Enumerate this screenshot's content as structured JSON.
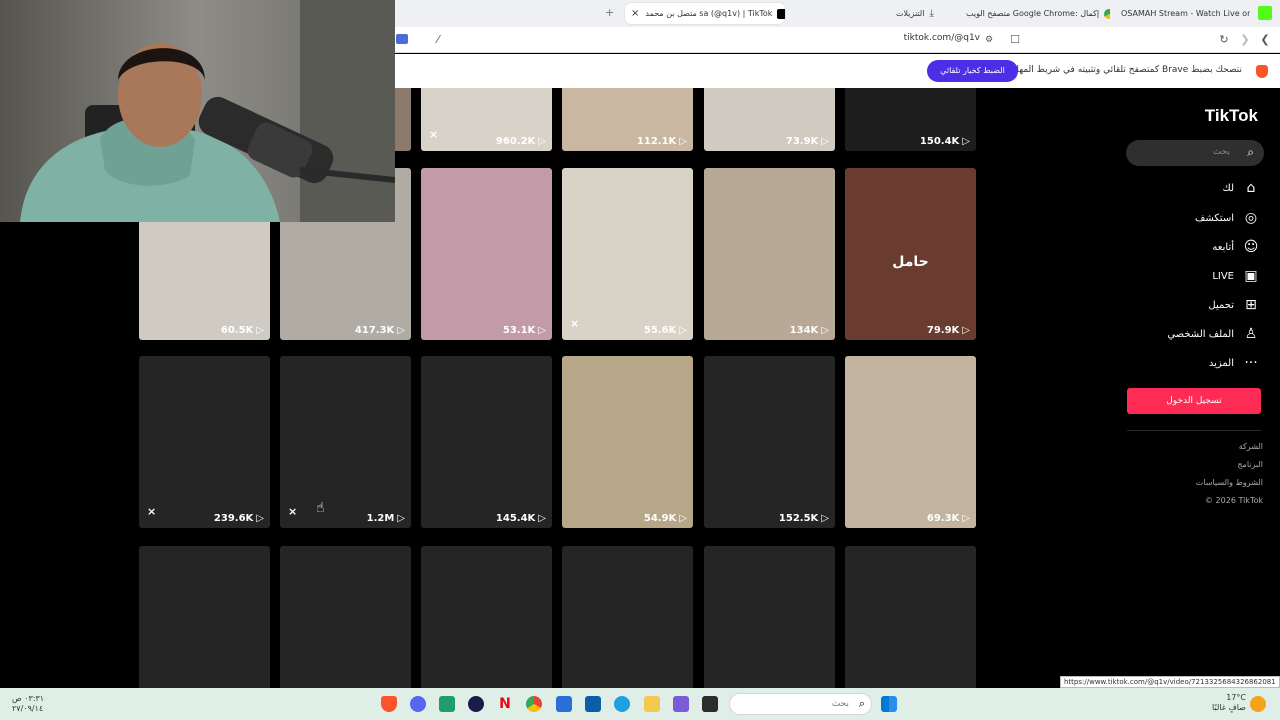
{
  "browser": {
    "tabs": [
      {
        "label": "OSAMAH Stream - Watch Live on Ki",
        "active": false
      },
      {
        "label": "متصفح الويب Google Chrome: إكمال",
        "active": false
      },
      {
        "label": "التنزيلات",
        "active": false
      },
      {
        "label": "متصل بن محمد sa (@q1v) | TikTok",
        "active": true
      }
    ],
    "new_tab": "+",
    "close_tab": "×",
    "url": "tiktok.com/@q1v",
    "infobar_text": "نتصحك بضبط Brave كمتصفح تلقائي وتثبيته في شريط المهام",
    "infobar_button": "الضبط كخيار تلقائي",
    "status_url": "https://www.tiktok.com/@q1v/video/7213325684326862081"
  },
  "tiktok": {
    "logo": "TikTok",
    "search_placeholder": "بحث",
    "menu": [
      {
        "label": "لك",
        "icon": "home-icon",
        "glyph": "⌂"
      },
      {
        "label": "استكشف",
        "icon": "compass-icon",
        "glyph": "◎"
      },
      {
        "label": "أتابعه",
        "icon": "following-icon",
        "glyph": "☺"
      },
      {
        "label": "LIVE",
        "icon": "live-icon",
        "glyph": "▣"
      },
      {
        "label": "تحميل",
        "icon": "upload-icon",
        "glyph": "⊞"
      },
      {
        "label": "الملف الشخصي",
        "icon": "profile-icon",
        "glyph": "♙"
      },
      {
        "label": "المزيد",
        "icon": "more-icon",
        "glyph": "···"
      }
    ],
    "login_button": "تسجيل الدخول",
    "footer": [
      "الشركة",
      "البرنامج",
      "الشروط والسياسات",
      "© 2026 TikTok"
    ],
    "accent_color": "#fe2c55"
  },
  "videos": {
    "rows": [
      [
        "",
        "",
        "960.2K",
        "112.1K",
        "73.9K",
        "150.4K"
      ],
      [
        "60.5K",
        "417.3K",
        "53.1K",
        "55.6K",
        "134K",
        "79.9K"
      ],
      [
        "239.6K",
        "1.2M",
        "145.4K",
        "54.9K",
        "152.5K",
        "69.3K"
      ],
      [
        "",
        "",
        "",
        "",
        "",
        ""
      ]
    ],
    "captions": {
      "r1c6": "حامل"
    },
    "play_glyph": "▷",
    "mute_glyph": "🔇"
  },
  "taskbar": {
    "search_placeholder": "بحث",
    "time": "٠٣:٣١ ص",
    "date": "٢٧/٠٩/١٤",
    "temperature": "17°C",
    "weather": "صافٍ غالبًا"
  }
}
